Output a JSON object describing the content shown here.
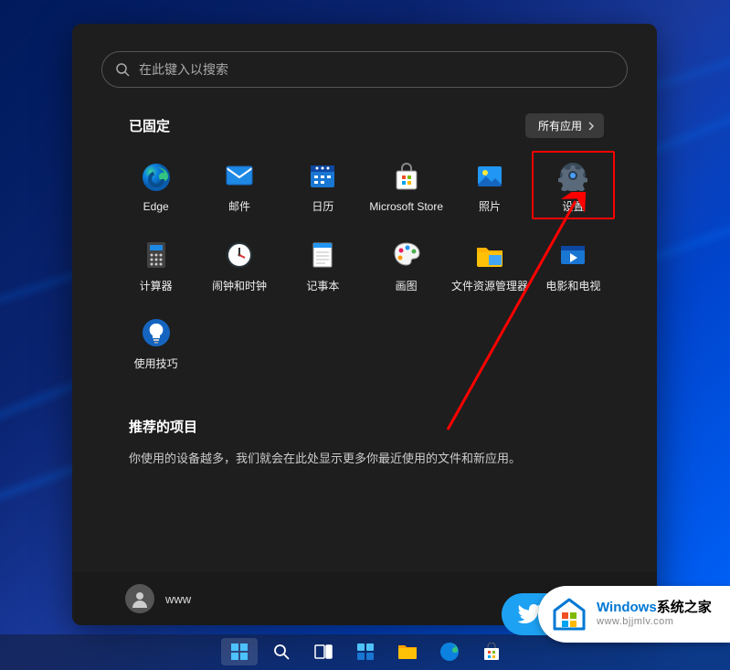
{
  "search": {
    "placeholder": "在此键入以搜索"
  },
  "pinned": {
    "title": "已固定",
    "all_apps_label": "所有应用",
    "tiles": [
      {
        "label": "Edge",
        "icon": "edge"
      },
      {
        "label": "邮件",
        "icon": "mail"
      },
      {
        "label": "日历",
        "icon": "calendar"
      },
      {
        "label": "Microsoft Store",
        "icon": "store"
      },
      {
        "label": "照片",
        "icon": "photos"
      },
      {
        "label": "设置",
        "icon": "settings",
        "highlight": true
      },
      {
        "label": "计算器",
        "icon": "calculator"
      },
      {
        "label": "闹钟和时钟",
        "icon": "clock"
      },
      {
        "label": "记事本",
        "icon": "notepad"
      },
      {
        "label": "画图",
        "icon": "paint"
      },
      {
        "label": "文件资源管理器",
        "icon": "explorer"
      },
      {
        "label": "电影和电视",
        "icon": "movies"
      },
      {
        "label": "使用技巧",
        "icon": "tips"
      }
    ]
  },
  "recommended": {
    "title": "推荐的项目",
    "text": "你使用的设备越多，我们就会在此处显示更多你最近使用的文件和新应用。"
  },
  "user": {
    "name": "www"
  },
  "taskbar": {
    "items": [
      {
        "name": "start",
        "active": true
      },
      {
        "name": "search"
      },
      {
        "name": "taskview"
      },
      {
        "name": "widgets"
      },
      {
        "name": "explorer"
      },
      {
        "name": "edge"
      },
      {
        "name": "store"
      }
    ]
  },
  "watermark": {
    "title_prefix": "Windows",
    "title_suffix": "系统之家",
    "url": "www.bjjmlv.com"
  },
  "chart_data": null
}
